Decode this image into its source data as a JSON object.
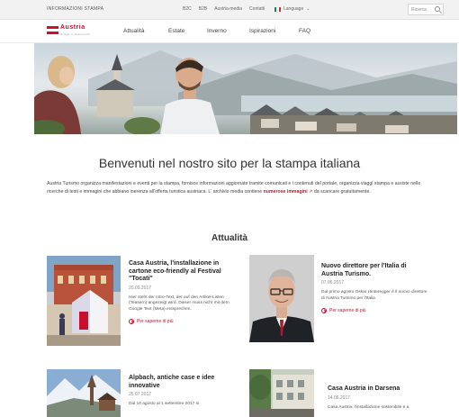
{
  "topbar": {
    "section_label": "INFORMAZIONI STAMPA",
    "links": [
      "B2C",
      "B2B",
      "Austria-media",
      "Contatti"
    ],
    "language_label": "Language",
    "search_placeholder": "Ricerca"
  },
  "logo": {
    "word": "Austria",
    "sub": "Urlaub in Österreich"
  },
  "nav": {
    "items": [
      "Attualità",
      "Estate",
      "Inverno",
      "Ispirazioni",
      "FAQ"
    ]
  },
  "intro": {
    "title": "Benvenuti nel nostro sito per la stampa italiana",
    "text_before": "Austria Turismo organizza manifestazioni e eventi per la stampa, fornisce informazioni aggiornate tramite comunicati e i contenuti del portale, organizza viaggi stampa e assiste nelle ricerche di testi e immagini che abbiano inerenza all'offerta turistica austriaca. L' archivio media contiene ",
    "link_text": "numerose immagini",
    "text_after": " da scaricare gratuitamente."
  },
  "section": {
    "title": "Attualità"
  },
  "cards": [
    {
      "title": "Casa Austria, l'installazione in cartone eco-friendly al Festival \"Tocati\"",
      "date": "20.09.2017",
      "text": "Hier steht der Intro-Text, der auf den Artikel-Listen (Teasern) angezeigt wird. Dieser muss nicht mit dem Google Text (Meta) entsprechen.",
      "more": "Per saperne di più"
    },
    {
      "title": "Nuovo direttore per l'Italia di Austria Turismo.",
      "date": "07.06.2017",
      "text": "Dal primo agosto Oskar Hinteregger è il nuovo direttore di Austria Turismo per l'Italia",
      "more": "Per saperne di più"
    },
    {
      "title": "Alpbach, antiche case e idee innovative",
      "date": "25.07.2017",
      "text": "Dal 16 agosto al 1 settembre 2017 si",
      "more": ""
    },
    {
      "title": "Casa Austria in Darsena",
      "date": "14.06.2017",
      "text": "Casa Austria, l'installazione sostenibile e a",
      "more": ""
    }
  ],
  "colors": {
    "accent": "#c8102e",
    "topbar_bg": "#f2f2f2"
  }
}
